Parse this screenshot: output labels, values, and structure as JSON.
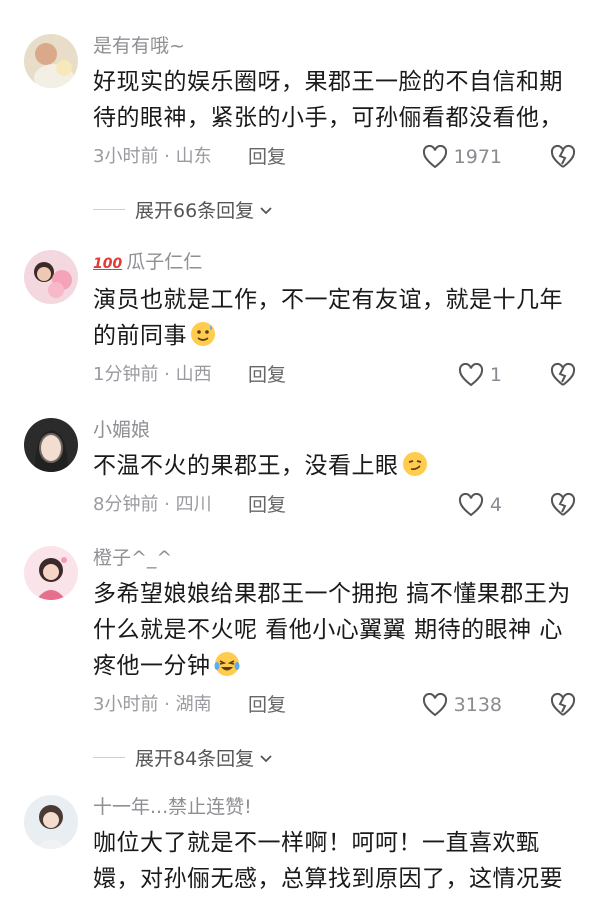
{
  "comments": [
    {
      "username": "是有有哦~",
      "text": "好现实的娱乐圈呀，果郡王一脸的不自信和期待的眼神，紧张的小手，可孙俪看都没看他，",
      "time_location": "3小时前 · 山东",
      "reply_label": "回复",
      "likes": "1971",
      "expand_label": "展开66条回复"
    },
    {
      "badge": "100",
      "username": "瓜子仁仁",
      "text": "演员也就是工作，不一定有友谊，就是十几年的前同事",
      "emoji": "sweat-smile-emoji",
      "time_location": "1分钟前 · 山西",
      "reply_label": "回复",
      "likes": "1"
    },
    {
      "username": "小媚娘",
      "text": "不温不火的果郡王，没看上眼",
      "emoji": "smirk-emoji",
      "time_location": "8分钟前 · 四川",
      "reply_label": "回复",
      "likes": "4"
    },
    {
      "username": "橙子^_^",
      "text": "多希望娘娘给果郡王一个拥抱 搞不懂果郡王为什么就是不火呢 看他小心翼翼 期待的眼神 心疼他一分钟",
      "emoji": "laughing-tears-emoji",
      "time_location": "3小时前 · 湖南",
      "reply_label": "回复",
      "likes": "3138",
      "expand_label": "展开84条回复"
    },
    {
      "username": "十一年...禁止连赞!",
      "text": "咖位大了就是不一样啊！呵呵！一直喜欢甄嬛，对孙俪无感，总算找到原因了，这情况要"
    }
  ],
  "colors": {
    "meta": "#9a9aa0",
    "username": "#8f8f94",
    "text": "#1a1a1a"
  }
}
